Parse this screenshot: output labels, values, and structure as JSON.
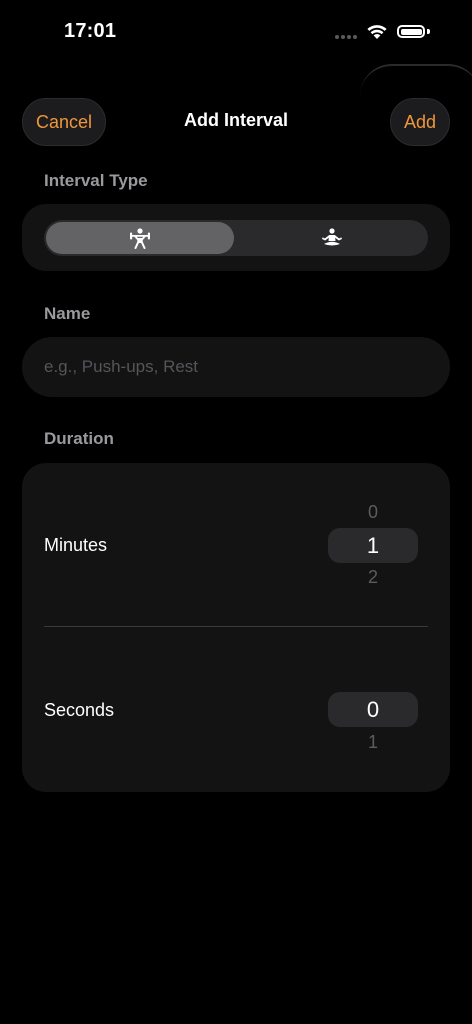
{
  "status_bar": {
    "time": "17:01"
  },
  "nav": {
    "cancel_label": "Cancel",
    "title": "Add Interval",
    "add_label": "Add"
  },
  "interval_type": {
    "label": "Interval Type",
    "options": [
      {
        "icon": "weightlifting-icon",
        "selected": true
      },
      {
        "icon": "meditation-icon",
        "selected": false
      }
    ]
  },
  "name": {
    "label": "Name",
    "placeholder": "e.g., Push-ups, Rest",
    "value": ""
  },
  "duration": {
    "label": "Duration",
    "minutes": {
      "label": "Minutes",
      "above": "0",
      "selected": "1",
      "below": "2"
    },
    "seconds": {
      "label": "Seconds",
      "selected": "0",
      "below": "1"
    }
  },
  "colors": {
    "accent": "#f0973a",
    "background": "#000000",
    "card": "#131313"
  }
}
